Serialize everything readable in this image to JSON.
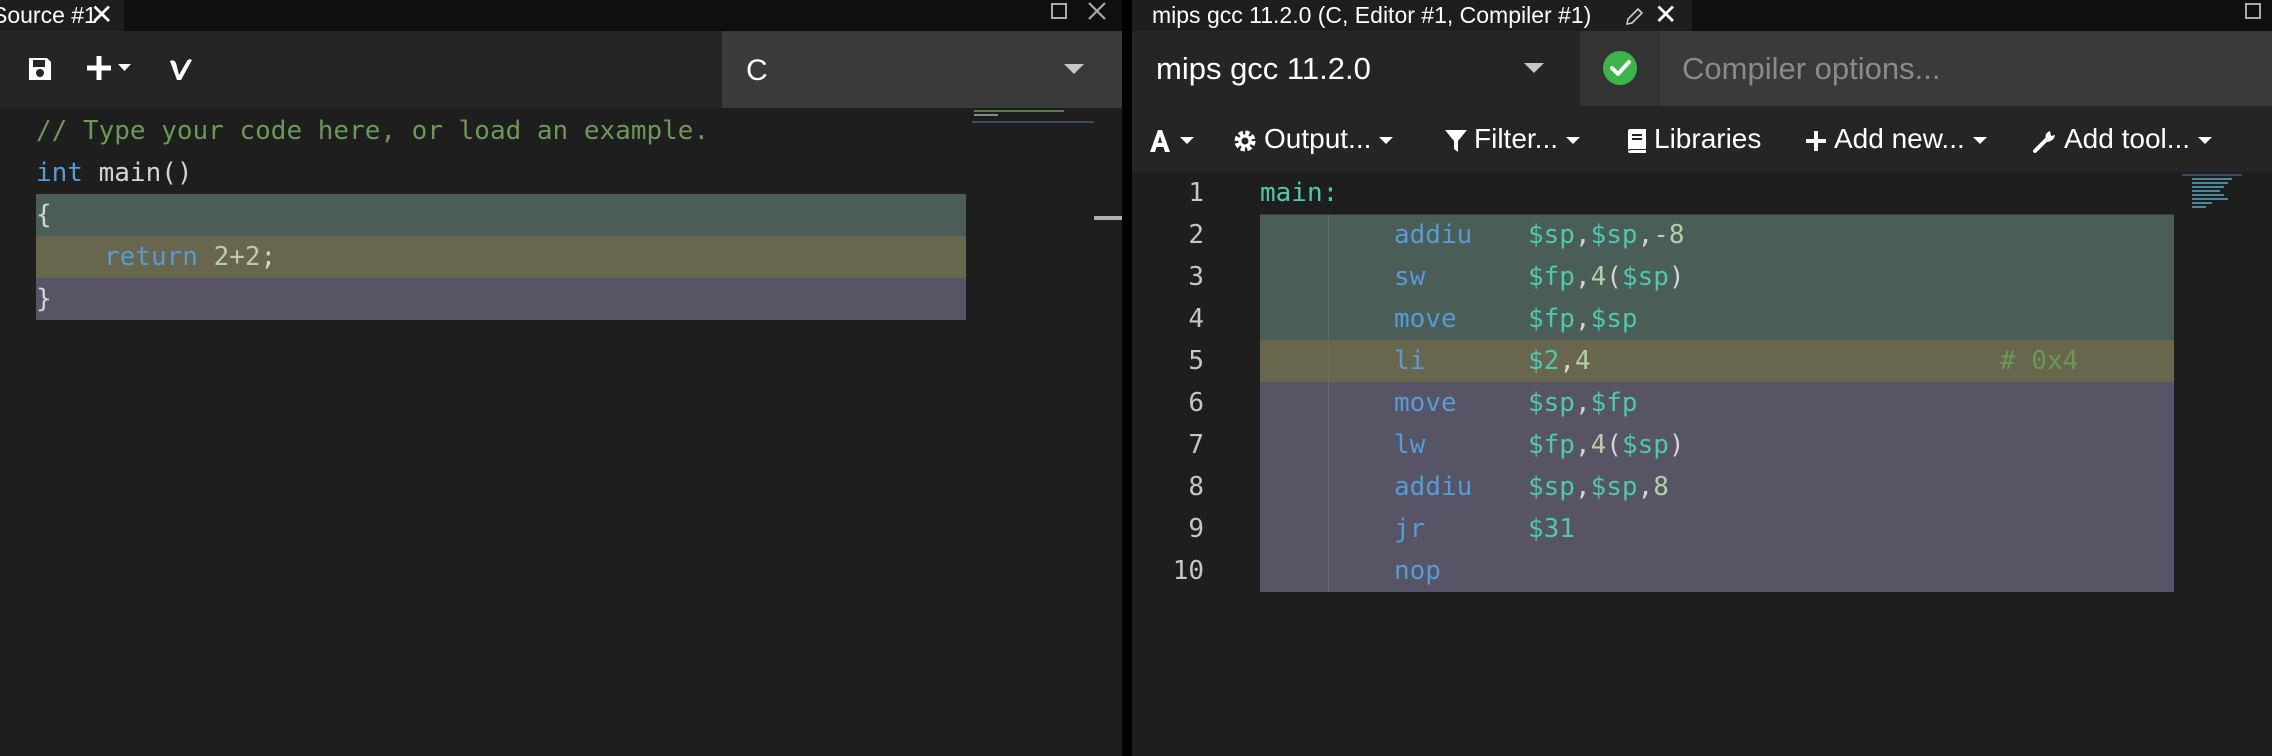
{
  "left": {
    "tab_title": "Source #1",
    "tab_close": "✕",
    "lang": "C",
    "code": {
      "line1": "// Type your code here, or load an example.",
      "line2_kw": "int",
      "line2_rest": " main()",
      "line3": "{",
      "line4_kw": "return",
      "line4_num": "2+2",
      "line4_end": ";",
      "line5": "}"
    }
  },
  "right": {
    "tab_title": "mips gcc 11.2.0 (C, Editor #1, Compiler #1)",
    "tab_close": "✕",
    "compiler": "mips gcc 11.2.0",
    "options_placeholder": "Compiler options...",
    "toolbar": {
      "output": "Output...",
      "filter": "Filter...",
      "libraries": "Libraries",
      "add_new": "Add new...",
      "add_tool": "Add tool..."
    },
    "asm": {
      "label": "main:",
      "lines": [
        {
          "op": "addiu",
          "a": "$sp",
          "b": "$sp",
          "c": "-8"
        },
        {
          "op": "sw",
          "a": "$fp",
          "b": "4",
          "c": "$sp"
        },
        {
          "op": "move",
          "a": "$fp",
          "b": "$sp"
        },
        {
          "op": "li",
          "a": "$2",
          "b": "4",
          "comment": "# 0x4"
        },
        {
          "op": "move",
          "a": "$sp",
          "b": "$fp"
        },
        {
          "op": "lw",
          "a": "$fp",
          "b": "4",
          "c": "$sp"
        },
        {
          "op": "addiu",
          "a": "$sp",
          "b": "$sp",
          "c": "8"
        },
        {
          "op": "jr",
          "a": "$31"
        },
        {
          "op": "nop"
        }
      ],
      "line_numbers": [
        "1",
        "2",
        "3",
        "4",
        "5",
        "6",
        "7",
        "8",
        "9",
        "10"
      ]
    }
  },
  "colors": {
    "green_hl": "#4a5d57",
    "olive_hl": "#68674d",
    "purple_hl": "#575465",
    "status_ok": "#3bb54a"
  }
}
